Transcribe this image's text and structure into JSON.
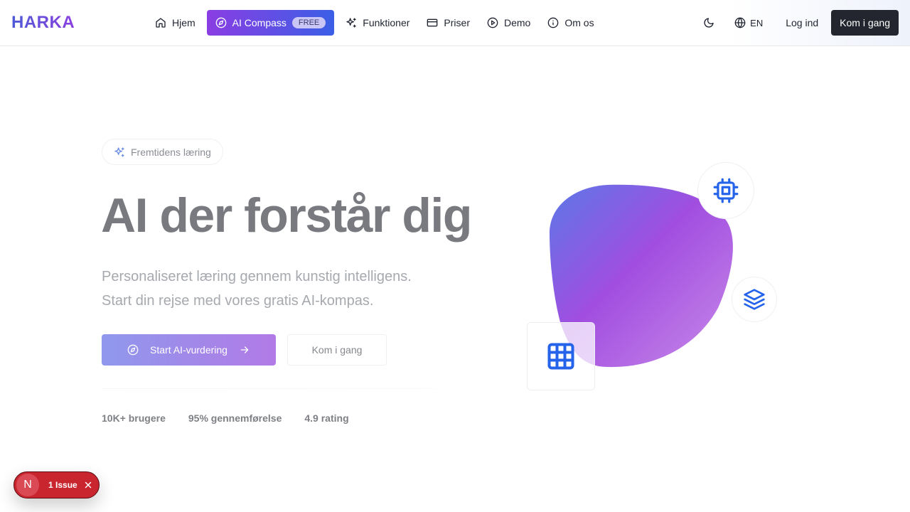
{
  "nav": {
    "logo": "HARKA",
    "links": [
      {
        "label": "Hjem",
        "icon": "home-icon"
      },
      {
        "label": "AI Compass",
        "icon": "compass-icon",
        "badge": "FREE",
        "active": true
      },
      {
        "label": "Funktioner",
        "icon": "sparkles-icon"
      },
      {
        "label": "Priser",
        "icon": "credit-card-icon"
      },
      {
        "label": "Demo",
        "icon": "play-circle-icon"
      },
      {
        "label": "Om os",
        "icon": "info-icon"
      }
    ],
    "language": "EN",
    "login_label": "Log ind",
    "cta_label": "Kom i gang"
  },
  "hero": {
    "badge": "Fremtidens læring",
    "title": "AI der forstår dig",
    "subtitle_line1": "Personaliseret læring gennem kunstig intelligens.",
    "subtitle_line2": "Start din rejse med vores gratis AI-kompas.",
    "primary_button": "Start AI-vurdering",
    "secondary_button": "Kom i gang",
    "stats": [
      "10K+ brugere",
      "95% gennemførelse",
      "4.9 rating"
    ]
  },
  "illustration": {
    "icons": [
      "cpu-icon",
      "layers-icon",
      "grid-icon"
    ],
    "gradient_start": "#5c78e8",
    "gradient_mid": "#a14ee0",
    "accent_blue": "#2563eb"
  },
  "dev_overlay": {
    "initial": "N",
    "issues_label": "1 Issue"
  },
  "colors": {
    "brand_gradient_start": "#8a3de3",
    "brand_gradient_end": "#3b5fe6",
    "cta_dark": "#23262e",
    "issue_red": "#c9252f"
  }
}
